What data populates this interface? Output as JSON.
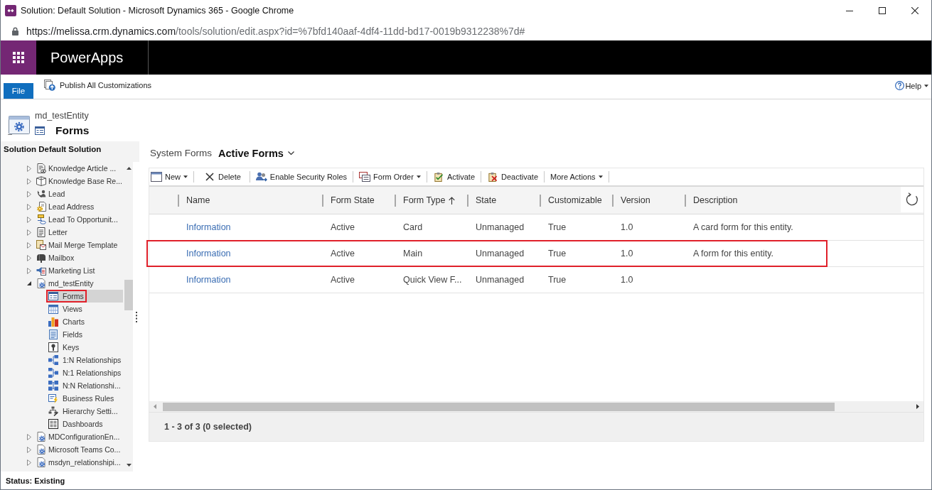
{
  "window": {
    "title": "Solution: Default Solution - Microsoft Dynamics 365 - Google Chrome"
  },
  "address_bar": {
    "host": "https://melissa.crm.dynamics.com",
    "path": "/tools/solution/edit.aspx?id=%7bfd140aaf-4df4-11dd-bd17-0019b9312238%7d#"
  },
  "app_bar": {
    "title": "PowerApps"
  },
  "ribbon": {
    "file_tab": "File",
    "commands": [
      "Publish All Customizations"
    ],
    "help": "Help"
  },
  "entity_header": {
    "entity": "md_testEntity",
    "title": "Forms"
  },
  "sidebar": {
    "title": "Solution Default Solution",
    "tree": [
      {
        "label": "Knowledge Article ...",
        "expanded": false,
        "selected": false
      },
      {
        "label": "Knowledge Base Re...",
        "expanded": false,
        "selected": false
      },
      {
        "label": "Lead",
        "expanded": false,
        "selected": false
      },
      {
        "label": "Lead Address",
        "expanded": false,
        "selected": false
      },
      {
        "label": "Lead To Opportunit...",
        "expanded": false,
        "selected": false
      },
      {
        "label": "Letter",
        "expanded": false,
        "selected": false
      },
      {
        "label": "Mail Merge Template",
        "expanded": false,
        "selected": false
      },
      {
        "label": "Mailbox",
        "expanded": false,
        "selected": false
      },
      {
        "label": "Marketing List",
        "expanded": false,
        "selected": false
      },
      {
        "label": "md_testEntity",
        "expanded": true,
        "selected": false,
        "children": [
          {
            "label": "Forms",
            "selected": true,
            "highlighted": true
          },
          {
            "label": "Views",
            "selected": false,
            "highlighted": false
          },
          {
            "label": "Charts",
            "selected": false,
            "highlighted": false
          },
          {
            "label": "Fields",
            "selected": false,
            "highlighted": false
          },
          {
            "label": "Keys",
            "selected": false,
            "highlighted": false
          },
          {
            "label": "1:N Relationships",
            "selected": false,
            "highlighted": false
          },
          {
            "label": "N:1 Relationships",
            "selected": false,
            "highlighted": false
          },
          {
            "label": "N:N Relationshi...",
            "selected": false,
            "highlighted": false
          },
          {
            "label": "Business Rules",
            "selected": false,
            "highlighted": false
          },
          {
            "label": "Hierarchy Setti...",
            "selected": false,
            "highlighted": false
          },
          {
            "label": "Dashboards",
            "selected": false,
            "highlighted": false
          }
        ]
      },
      {
        "label": "MDConfigurationEn...",
        "expanded": false,
        "selected": false
      },
      {
        "label": "Microsoft Teams Co...",
        "expanded": false,
        "selected": false
      },
      {
        "label": "msdyn_relationshipi...",
        "expanded": false,
        "selected": false
      }
    ]
  },
  "view": {
    "label": "System Forms",
    "selector": "Active Forms"
  },
  "toolbar": [
    {
      "label": "New",
      "dropdown": true
    },
    {
      "label": "Delete",
      "dropdown": false
    },
    {
      "label": "Enable Security Roles",
      "dropdown": false
    },
    {
      "label": "Form Order",
      "dropdown": true
    },
    {
      "label": "Activate",
      "dropdown": false
    },
    {
      "label": "Deactivate",
      "dropdown": false
    },
    {
      "label": "More Actions",
      "dropdown": true
    }
  ],
  "table": {
    "columns": [
      {
        "label": "Name",
        "sorted": false
      },
      {
        "label": "Form State",
        "sorted": false
      },
      {
        "label": "Form Type",
        "sorted": true
      },
      {
        "label": "State",
        "sorted": false
      },
      {
        "label": "Customizable",
        "sorted": false
      },
      {
        "label": "Version",
        "sorted": false
      },
      {
        "label": "Description",
        "sorted": false
      }
    ],
    "rows": [
      {
        "highlighted": false,
        "cells": [
          "Information",
          "Active",
          "Card",
          "Unmanaged",
          "True",
          "1.0",
          "A card form for this entity."
        ]
      },
      {
        "highlighted": true,
        "cells": [
          "Information",
          "Active",
          "Main",
          "Unmanaged",
          "True",
          "1.0",
          "A form for this entity."
        ]
      },
      {
        "highlighted": false,
        "cells": [
          "Information",
          "Active",
          "Quick View F...",
          "Unmanaged",
          "True",
          "1.0"
        ]
      }
    ],
    "footer": "1 - 3 of 3 (0 selected)"
  },
  "status_bar": {
    "text": "Status: Existing"
  }
}
